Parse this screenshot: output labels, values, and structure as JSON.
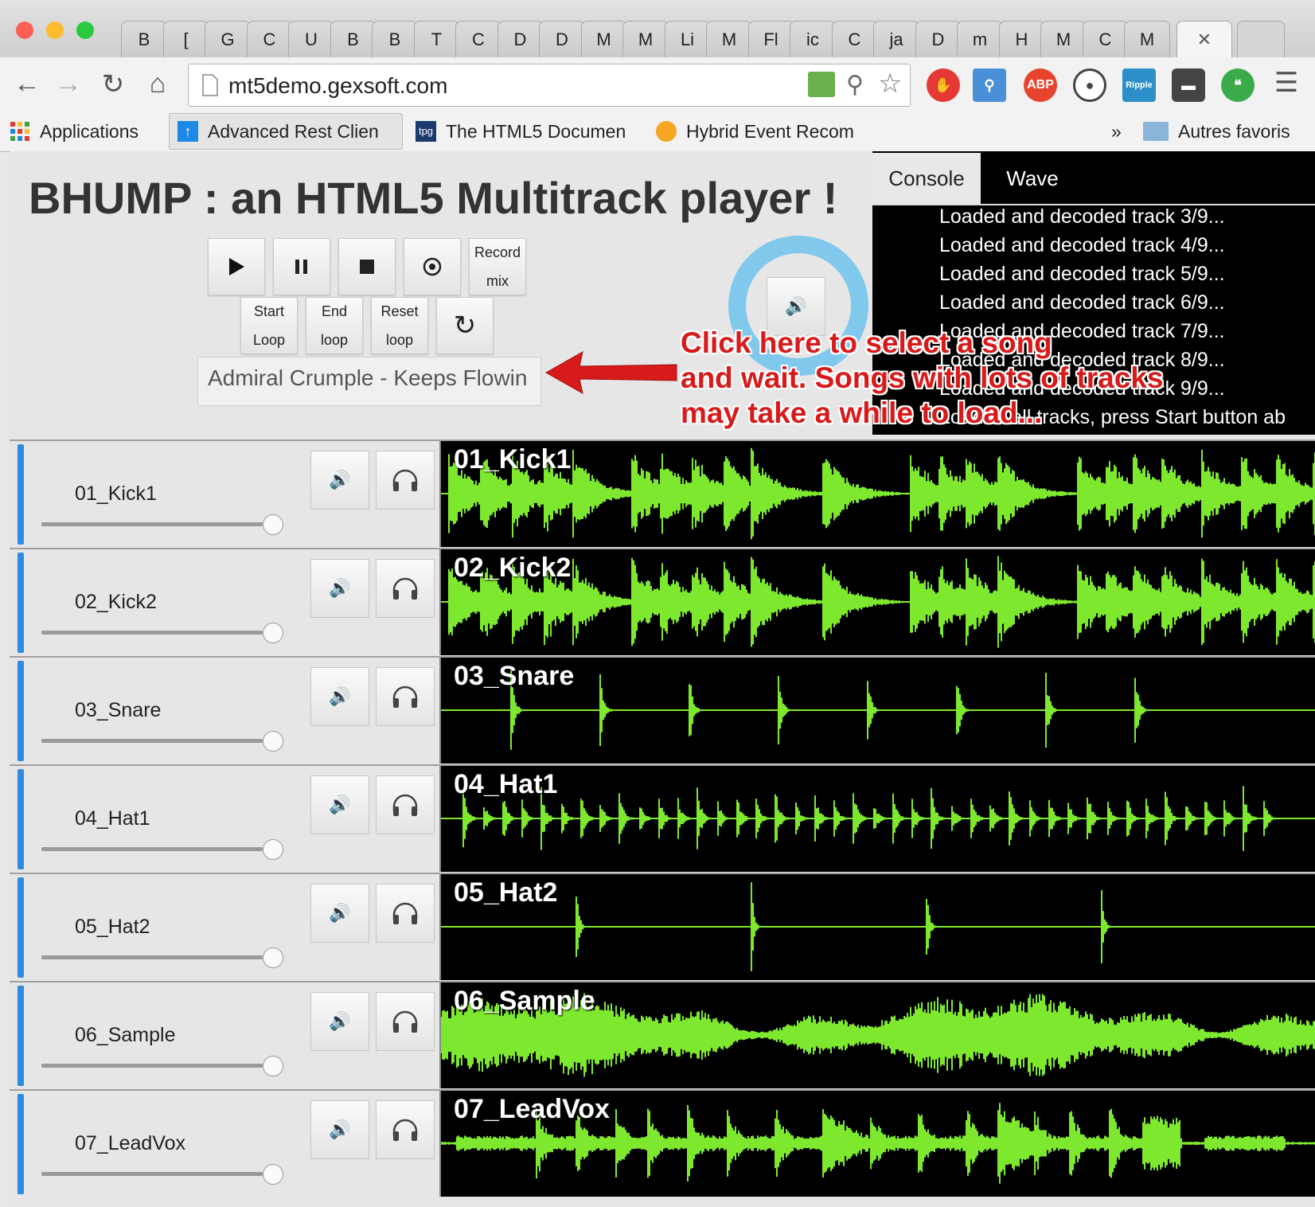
{
  "browser": {
    "tabs": [
      "B",
      "[",
      "G",
      "C",
      "U",
      "B",
      "B",
      "T",
      "C",
      "D",
      "D",
      "M",
      "M",
      "Li",
      "M",
      "Fl",
      "ic",
      "C",
      "ja",
      "D",
      "m",
      "H",
      "M",
      "C",
      "M"
    ],
    "url": "mt5demo.gexsoft.com",
    "bookmarks": [
      "Applications",
      "Advanced Rest Clien",
      "The HTML5 Documen",
      "Hybrid Event Recom"
    ],
    "bookmarks_overflow": "»",
    "other_bookmarks": "Autres favoris",
    "close_tab": "✕"
  },
  "page": {
    "title": "BHUMP : an HTML5 Multitrack player !",
    "controls": {
      "record_line1": "Record",
      "record_line2": "mix",
      "start_line1": "Start",
      "start_line2": "Loop",
      "end_line1": "End",
      "end_line2": "loop",
      "reset_line1": "Reset",
      "reset_line2": "loop"
    },
    "song_select": "Admiral Crumple - Keeps Flowin",
    "console_tab": "Console",
    "wave_tab": "Wave",
    "console_lines": [
      "Loaded and decoded track 3/9...",
      "Loaded and decoded track 4/9...",
      "Loaded and decoded track 5/9...",
      "Loaded and decoded track 6/9...",
      "Loaded and decoded track 7/9...",
      "Loaded and decoded track 8/9...",
      "Loaded and decoded track 9/9...",
      "Loaded all tracks, press Start button ab"
    ],
    "annotation": [
      "Click here to select a song",
      "and wait. Songs with lots of tracks",
      "may take a while to load..."
    ],
    "annotation_color": "#d81a1a",
    "wave_color": "#7ee82e",
    "track_bar_color": "#2e8be0"
  },
  "tracks": [
    {
      "name": "01_Kick1",
      "pattern": "kick"
    },
    {
      "name": "02_Kick2",
      "pattern": "kick"
    },
    {
      "name": "03_Snare",
      "pattern": "snare"
    },
    {
      "name": "04_Hat1",
      "pattern": "hat1"
    },
    {
      "name": "05_Hat2",
      "pattern": "hat2"
    },
    {
      "name": "06_Sample",
      "pattern": "sample"
    },
    {
      "name": "07_LeadVox",
      "pattern": "vox"
    }
  ]
}
